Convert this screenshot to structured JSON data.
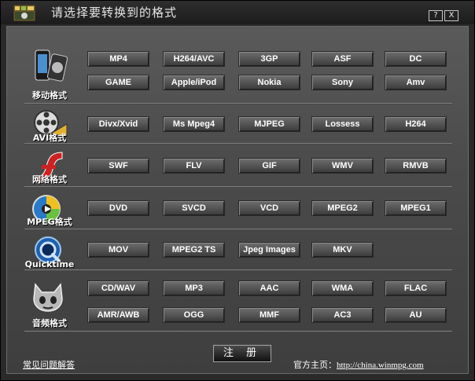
{
  "window": {
    "title": "请选择要转换到的格式",
    "help_label": "?",
    "close_label": "X"
  },
  "categories": [
    {
      "label": "移动格式",
      "icon": "phone-icon",
      "formats": [
        "MP4",
        "H264/AVC",
        "3GP",
        "ASF",
        "DC",
        "GAME",
        "Apple/iPod",
        "Nokia",
        "Sony",
        "Amv"
      ]
    },
    {
      "label": "AVI格式",
      "icon": "film-reel-icon",
      "formats": [
        "Divx/Xvid",
        "Ms Mpeg4",
        "MJPEG",
        "Lossess",
        "H264"
      ]
    },
    {
      "label": "网络格式",
      "icon": "flash-icon",
      "formats": [
        "SWF",
        "FLV",
        "GIF",
        "WMV",
        "RMVB"
      ]
    },
    {
      "label": "MPEG格式",
      "icon": "disc-icon",
      "formats": [
        "DVD",
        "SVCD",
        "VCD",
        "MPEG2",
        "MPEG1"
      ]
    },
    {
      "label": "Quicktime",
      "icon": "quicktime-icon",
      "formats": [
        "MOV",
        "MPEG2 TS",
        "Jpeg Images",
        "MKV"
      ]
    },
    {
      "label": "音频格式",
      "icon": "audio-cat-icon",
      "formats": [
        "CD/WAV",
        "MP3",
        "AAC",
        "WMA",
        "FLAC",
        "AMR/AWB",
        "OGG",
        "MMF",
        "AC3",
        "AU"
      ]
    }
  ],
  "footer": {
    "register_label": "注 册",
    "faq_label": "常见问题解答",
    "site_prefix": "官方主页：",
    "site_url": "http://china.winmpg.com"
  },
  "colors": {
    "accent_red": "#cc2222",
    "panel_gray": "#4b4b4b"
  }
}
